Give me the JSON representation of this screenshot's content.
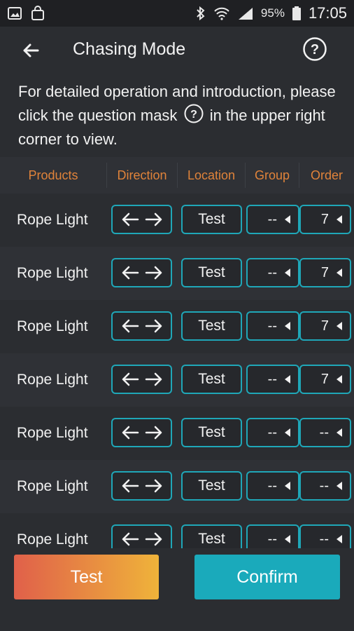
{
  "status_bar": {
    "left_icons": [
      "gallery-icon",
      "shopping-bag-icon"
    ],
    "right_icons": [
      "bluetooth-icon",
      "wifi-icon",
      "signal-icon"
    ],
    "battery": "95%",
    "time": "17:05"
  },
  "header": {
    "title": "Chasing Mode",
    "back_icon": "back-arrow-icon",
    "help_icon": "help-circle-icon"
  },
  "intro": {
    "line_before_icon": "For detailed operation and introduction, please click the question mask",
    "line_after_icon": "in the upper right corner to view."
  },
  "table": {
    "columns": [
      "Products",
      "Direction",
      "Location",
      "Group",
      "Order"
    ],
    "rows": [
      {
        "product": "Rope Light",
        "direction": "← →",
        "location": "Test",
        "group": "--",
        "order": "7"
      },
      {
        "product": "Rope Light",
        "direction": "← →",
        "location": "Test",
        "group": "--",
        "order": "7"
      },
      {
        "product": "Rope Light",
        "direction": "← →",
        "location": "Test",
        "group": "--",
        "order": "7"
      },
      {
        "product": "Rope Light",
        "direction": "← →",
        "location": "Test",
        "group": "--",
        "order": "7"
      },
      {
        "product": "Rope Light",
        "direction": "← →",
        "location": "Test",
        "group": "--",
        "order": "--"
      },
      {
        "product": "Rope Light",
        "direction": "← →",
        "location": "Test",
        "group": "--",
        "order": "--"
      },
      {
        "product": "Rope Light",
        "direction": "← →",
        "location": "Test",
        "group": "--",
        "order": "--"
      }
    ]
  },
  "footer": {
    "test_label": "Test",
    "confirm_label": "Confirm"
  },
  "colors": {
    "accent": "#1aaabb",
    "header_text": "#e0833a",
    "background": "#2b2d31"
  }
}
